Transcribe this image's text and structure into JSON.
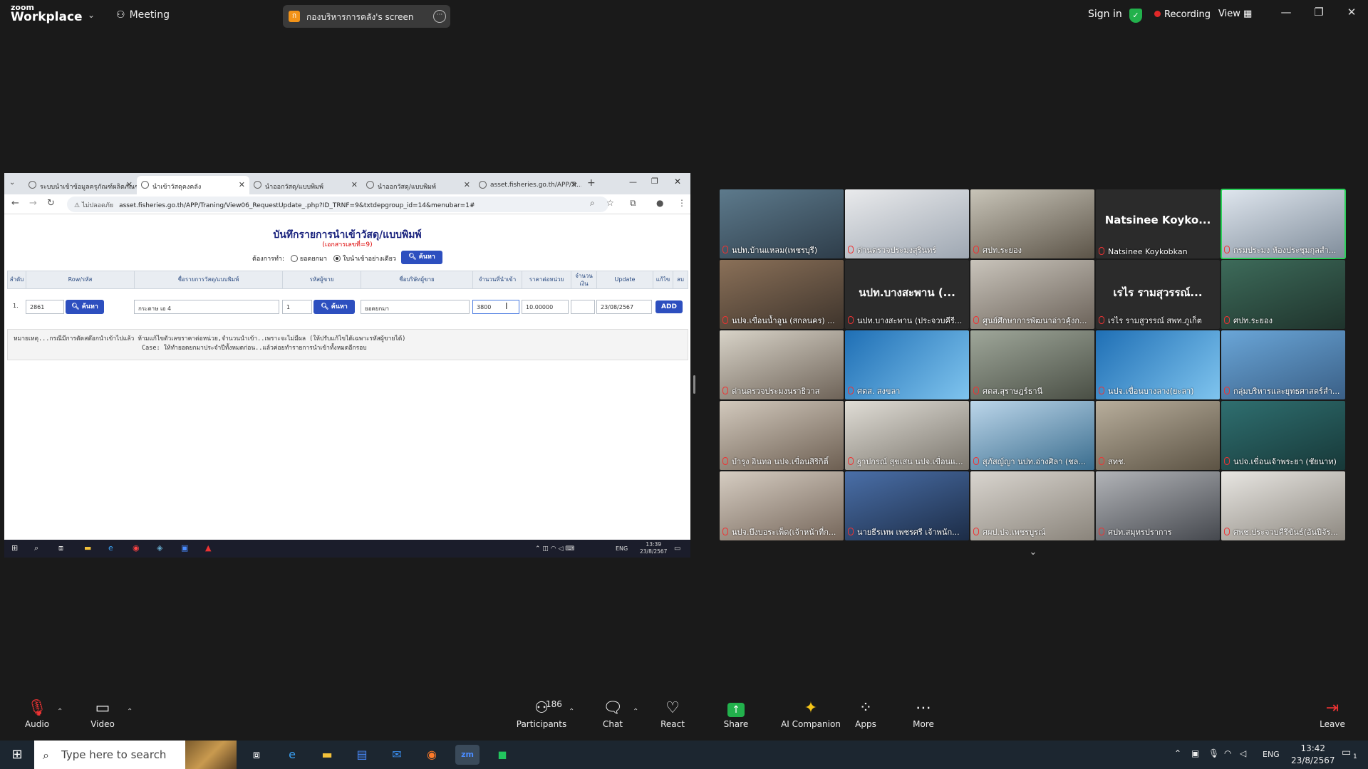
{
  "zoom": {
    "logo_small": "zoom",
    "logo_big": "Workplace",
    "meeting_label": "Meeting",
    "share_title": "กองบริหารการคลัง's screen",
    "sign_in": "Sign in",
    "recording": "Recording",
    "view": "View",
    "toolbar": {
      "audio": "Audio",
      "video": "Video",
      "participants": "Participants",
      "participant_count": "186",
      "chat": "Chat",
      "react": "React",
      "share": "Share",
      "ai": "AI Companion",
      "apps": "Apps",
      "more": "More",
      "leave": "Leave"
    }
  },
  "browser": {
    "tabs": [
      {
        "label": "ระบบนำเข้าข้อมูลครุภัณฑ์ผลิตภัณฑ์ฯ"
      },
      {
        "label": "นำเข้าวัสดุคงคลัง",
        "active": true
      },
      {
        "label": "นำออกวัสดุ/แบบพิมพ์"
      },
      {
        "label": "นำออกวัสดุ/แบบพิมพ์"
      },
      {
        "label": "asset.fisheries.go.th/APP/Tr..."
      }
    ],
    "security": "ไม่ปลอดภัย",
    "url": "asset.fisheries.go.th/APP/Traning/View06_RequestUpdate_.php?ID_TRNF=9&txtdepgroup_id=14&menubar=1#"
  },
  "form": {
    "title": "บันทึกรายการนำเข้าวัสดุ/แบบพิมพ์",
    "subtitle": "(เอกสารเลขที่=9)",
    "option_label": "ต้องการทำ:",
    "option_1": "ยอดยกมา",
    "option_2": "ใบนำเข้าอย่างเดียว",
    "search_btn": "ค้นหา",
    "columns": [
      "ลำดับ",
      "Row/รหัส",
      "ชื่อรายการวัสดุ/แบบพิมพ์",
      "รหัสผู้ขาย",
      "ชื่อบริษัทผู้ขาย",
      "จำนวนที่นำเข้า",
      "ราคาต่อหน่วย",
      "จำนวนเงิน",
      "Update",
      "แก้ไข",
      "ลบ"
    ],
    "row": {
      "index": "1.",
      "code": "2861",
      "item": "กระดาษ เอ 4",
      "vendor_code": "1",
      "vendor_name": "ยอดยกมา",
      "qty": "3800",
      "price": "10.00000",
      "amount": "",
      "date": "23/08/2567",
      "add_btn": "ADD"
    },
    "note_line1": "หมายเหตุ...กรณีมีการตัดสต๊อกนำเข้าไปแล้ว ห้ามแก้ไขตัวเลขราคาต่อหน่วย,จำนวนนำเข้า..เพราะจะไม่มีผล (ให้ปรับแก้ไขได้เฉพาะรหัสผู้ขายได้)",
    "note_line2": "Case: ให้ทำยอดยกมาประจำปีทั้งหมดก่อน..แล้วค่อยทำรายการนำเข้าทั้งหมดอีกรอบ"
  },
  "remote_taskbar": {
    "time": "13:39",
    "date": "23/8/2567",
    "lang": "ENG"
  },
  "gallery": [
    {
      "name": "นปท.บ้านแหลม(เพชรบุรี)"
    },
    {
      "name": "ด่านตรวจประมงสุรินทร์"
    },
    {
      "name": "ศปท.ระยอง"
    },
    {
      "name": "Natsinee Koykobkan",
      "big": "Natsinee Koyko..."
    },
    {
      "name": "กรมประมง ห้องประชุมกุลสำ...",
      "speaking": true
    },
    {
      "name": "นปจ.เขื่อนน้ำอูน (สกลนคร) ..."
    },
    {
      "name": "นปท.บางสะพาน (ประจวบคีรี...",
      "big": "นปท.บางสะพาน (..."
    },
    {
      "name": "ศูนย์ศึกษาการพัฒนาอ่าวคุ้งก..."
    },
    {
      "name": "เรไร รามสูวรรณ์ สพท.ภูเก็ต",
      "big": "เรไร รามสุวรรณ์..."
    },
    {
      "name": "ศปท.ระยอง"
    },
    {
      "name": "ด่านตรวจประมงนราธิวาส"
    },
    {
      "name": "ศตส. สงขลา"
    },
    {
      "name": "ศตส.สุราษฎร์ธานี"
    },
    {
      "name": "นปจ.เขื่อนบางลาง(ยะลา)"
    },
    {
      "name": "กลุ่มบริหารและยุทธศาสตร์สำ..."
    },
    {
      "name": "บำรุง อินทอ นปจ.เขื่อนสิริกิติ์"
    },
    {
      "name": "ฐาปกรณ์ สุขเสน นปจ.เขื่อนแ..."
    },
    {
      "name": "สุภัสญ์ญา นปท.อ่างศิลา (ชล..."
    },
    {
      "name": "สทช."
    },
    {
      "name": "นปจ.เขื่อนเจ้าพระยา (ชัยนาท)"
    },
    {
      "name": "นปจ.บึงบอระเพ็ด(เจ้าหน้าที่ก..."
    },
    {
      "name": "นายธีรเทพ เพชรศรี เจ้าพนัก..."
    },
    {
      "name": "ศผป.ปจ.เพชรบูรณ์"
    },
    {
      "name": "ศปท.สมุทรปราการ"
    },
    {
      "name": "ศพช.ประจวบคีรีขันธ์(อันปีจัร..."
    }
  ],
  "windows": {
    "search_placeholder": "Type here to search",
    "time": "13:42",
    "date": "23/8/2567",
    "lang": "ENG",
    "notif": "1"
  }
}
